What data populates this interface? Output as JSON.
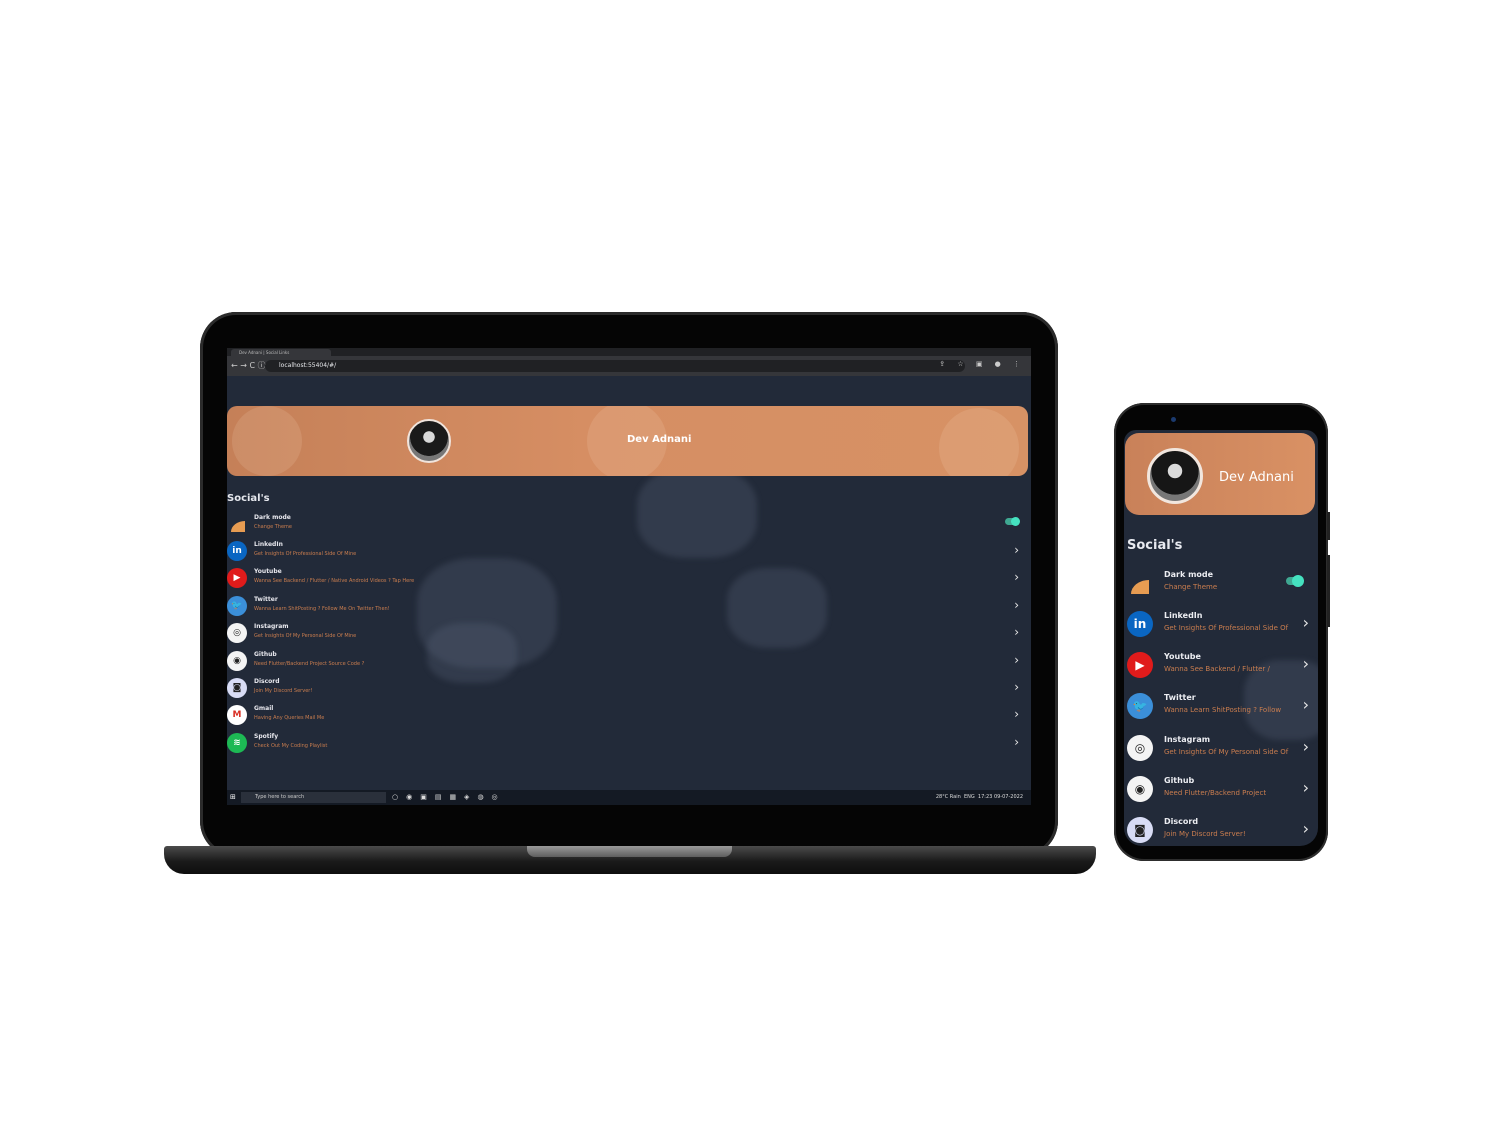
{
  "browser": {
    "tab_title": "Dev Adnani | Social Links",
    "url": "localhost:55404/#/",
    "nav": "← → C ⓘ",
    "actions": "⇪ ☆ ▣ ● ⋮"
  },
  "profile": {
    "name": "Dev Adnani"
  },
  "section_title": "Social's",
  "settings": {
    "dark_mode_title": "Dark mode",
    "dark_mode_subtitle": "Change Theme",
    "dark_mode_on": true
  },
  "socials": [
    {
      "title": "LinkedIn",
      "subtitle": "Get Insights Of Professional Side Of Mine",
      "subtitle_short": "Get Insights Of Professional Side Of",
      "icon": "linkedin-icon",
      "color": "#0a66c2",
      "glyph": "in"
    },
    {
      "title": "Youtube",
      "subtitle": "Wanna See Backend / Flutter / Native Android Videos ? Tap Here",
      "subtitle_short": "Wanna See Backend / Flutter /",
      "icon": "youtube-icon",
      "color": "#e01b1b",
      "glyph": "▶"
    },
    {
      "title": "Twitter",
      "subtitle": "Wanna Learn ShitPosting ? Follow Me On Twitter Then!",
      "subtitle_short": "Wanna Learn ShitPosting ? Follow",
      "icon": "twitter-icon",
      "color": "#3b8fd9",
      "glyph": "🐦"
    },
    {
      "title": "Instagram",
      "subtitle": "Get Insights Of My Personal Side Of Mine",
      "subtitle_short": "Get Insights Of My Personal Side Of",
      "icon": "instagram-icon",
      "color": "#f4f4f4",
      "glyph": "◎"
    },
    {
      "title": "Github",
      "subtitle": "Need Flutter/Backend Project Source Code ?",
      "subtitle_short": "Need Flutter/Backend Project",
      "icon": "github-icon",
      "color": "#f4f4f4",
      "glyph": "◉"
    },
    {
      "title": "Discord",
      "subtitle": "Join My Discord Server!",
      "subtitle_short": "Join My Discord Server!",
      "icon": "discord-icon",
      "color": "#d8dcf5",
      "glyph": "◙"
    },
    {
      "title": "Gmail",
      "subtitle": "Having Any Queries Mail Me",
      "icon": "gmail-icon",
      "color": "#ffffff",
      "glyph": "M"
    },
    {
      "title": "Spotify",
      "subtitle": "Check Out My Coding Playlist",
      "icon": "spotify-icon",
      "color": "#1db954",
      "glyph": "≋"
    }
  ],
  "taskbar": {
    "search_placeholder": "Type here to search",
    "weather": "28°C Rain",
    "language": "ENG",
    "time": "17:23",
    "date": "09-07-2022"
  }
}
